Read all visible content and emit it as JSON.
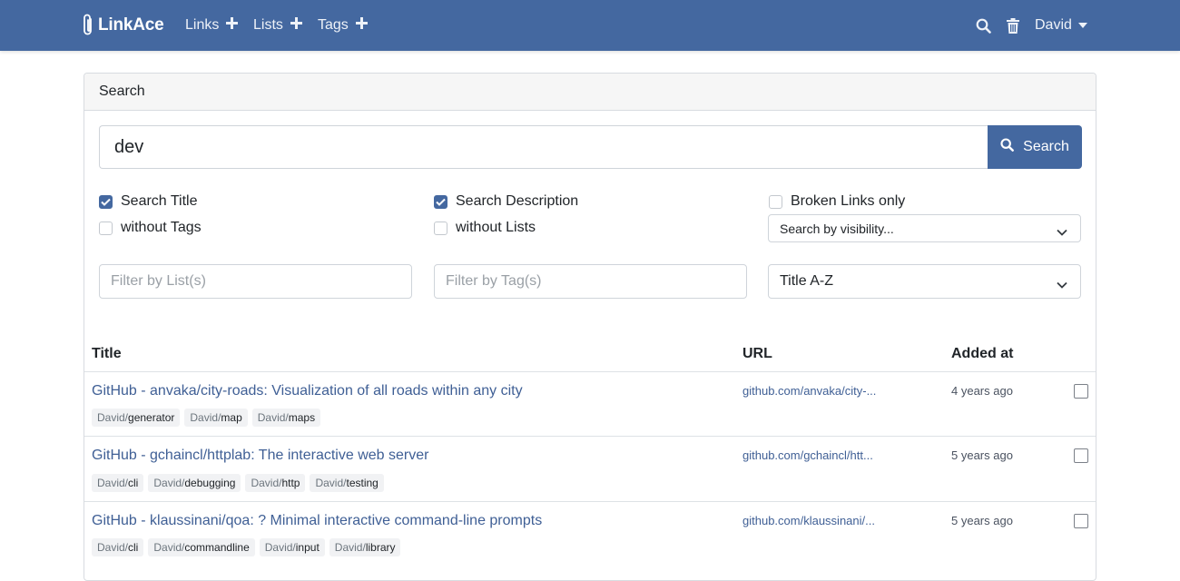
{
  "app": {
    "brand": "LinkAce"
  },
  "nav": {
    "links_label": "Links",
    "lists_label": "Lists",
    "tags_label": "Tags",
    "user_label": "David"
  },
  "search": {
    "card_title": "Search",
    "query": "dev",
    "button_label": "Search",
    "options": {
      "search_title": {
        "label": "Search Title",
        "checked": true
      },
      "search_description": {
        "label": "Search Description",
        "checked": true
      },
      "broken_links_only": {
        "label": "Broken Links only",
        "checked": false
      },
      "without_tags": {
        "label": "without Tags",
        "checked": false
      },
      "without_lists": {
        "label": "without Lists",
        "checked": false
      }
    },
    "visibility_select": "Search by visibility...",
    "filter_lists_placeholder": "Filter by List(s)",
    "filter_tags_placeholder": "Filter by Tag(s)",
    "order_select": "Title A-Z"
  },
  "table": {
    "columns": {
      "title": "Title",
      "url": "URL",
      "added_at": "Added at"
    },
    "rows": [
      {
        "title": "GitHub - anvaka/city-roads: Visualization of all roads within any city",
        "url": "github.com/anvaka/city-...",
        "added": "4 years ago",
        "tags": [
          {
            "ns": "David/",
            "name": "generator"
          },
          {
            "ns": "David/",
            "name": "map"
          },
          {
            "ns": "David/",
            "name": "maps"
          }
        ]
      },
      {
        "title": "GitHub - gchaincl/httplab: The interactive web server",
        "url": "github.com/gchaincl/htt...",
        "added": "5 years ago",
        "tags": [
          {
            "ns": "David/",
            "name": "cli"
          },
          {
            "ns": "David/",
            "name": "debugging"
          },
          {
            "ns": "David/",
            "name": "http"
          },
          {
            "ns": "David/",
            "name": "testing"
          }
        ]
      },
      {
        "title": "GitHub - klaussinani/qoa: ? Minimal interactive command-line prompts",
        "url": "github.com/klaussinani/...",
        "added": "5 years ago",
        "tags": [
          {
            "ns": "David/",
            "name": "cli"
          },
          {
            "ns": "David/",
            "name": "commandline"
          },
          {
            "ns": "David/",
            "name": "input"
          },
          {
            "ns": "David/",
            "name": "library"
          }
        ]
      }
    ]
  },
  "colors": {
    "primary": "#4468a0",
    "link": "#3f5f95"
  },
  "icons": [
    "paperclip-icon",
    "plus-icon",
    "search-icon",
    "trash-icon",
    "caret-down-icon",
    "chevron-down-icon",
    "check-icon"
  ]
}
